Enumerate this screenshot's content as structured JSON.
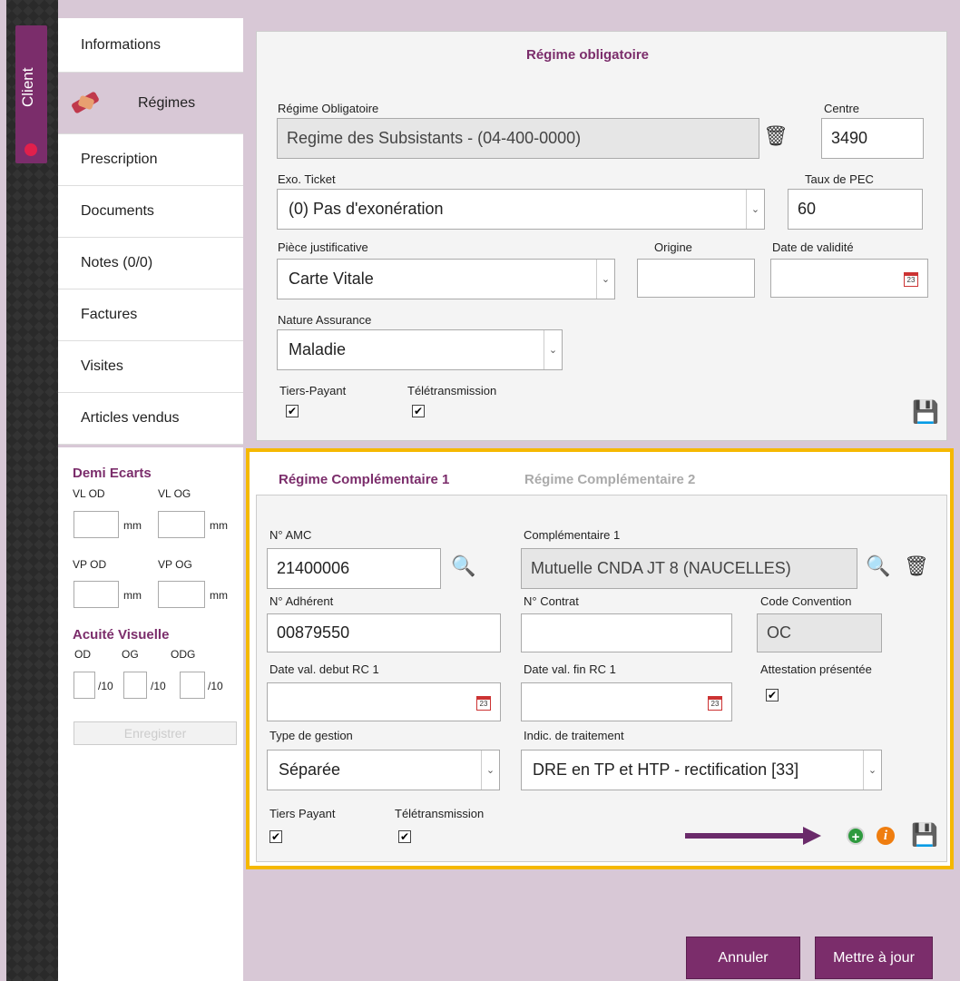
{
  "sidebar": {
    "client_tab": "Client",
    "items": [
      {
        "label": "Informations"
      },
      {
        "label": "Régimes"
      },
      {
        "label": "Prescription"
      },
      {
        "label": "Documents"
      },
      {
        "label": "Notes (0/0)"
      },
      {
        "label": "Factures"
      },
      {
        "label": "Visites"
      },
      {
        "label": "Articles vendus"
      }
    ]
  },
  "demi_ecarts": {
    "title": "Demi Ecarts",
    "vl_od": "VL OD",
    "vl_og": "VL OG",
    "vp_od": "VP OD",
    "vp_og": "VP OG",
    "unit": "mm"
  },
  "acuite": {
    "title": "Acuité Visuelle",
    "od": "OD",
    "og": "OG",
    "odg": "ODG",
    "unit": "/10"
  },
  "enregistrer": "Enregistrer",
  "regime_obligatoire": {
    "title": "Régime obligatoire",
    "regime_label": "Régime Obligatoire",
    "regime_value": "Regime des Subsistants - (04-400-0000)",
    "centre_label": "Centre",
    "centre_value": "3490",
    "exo_label": "Exo. Ticket",
    "exo_value": "(0) Pas d'exonération",
    "taux_label": "Taux de PEC",
    "taux_value": "60",
    "piece_label": "Pièce justificative",
    "piece_value": "Carte Vitale",
    "origine_label": "Origine",
    "origine_value": "",
    "date_validite_label": "Date de validité",
    "nature_label": "Nature Assurance",
    "nature_value": "Maladie",
    "tiers_payant_label": "Tiers-Payant",
    "teletransmission_label": "Télétransmission"
  },
  "regime_complementaire": {
    "tab1": "Régime Complémentaire 1",
    "tab2": "Régime Complémentaire 2",
    "amc_label": "N° AMC",
    "amc_value": "21400006",
    "comp_label": "Complémentaire 1",
    "comp_value": "Mutuelle CNDA JT 8 (NAUCELLES)",
    "adherent_label": "N° Adhérent",
    "adherent_value": "00879550",
    "contrat_label": "N° Contrat",
    "contrat_value": "",
    "convention_label": "Code Convention",
    "convention_value": "OC",
    "debut_label": "Date val. debut RC 1",
    "fin_label": "Date val. fin RC 1",
    "attestation_label": "Attestation présentée",
    "gestion_label": "Type de gestion",
    "gestion_value": "Séparée",
    "indic_label": "Indic. de traitement",
    "indic_value": "DRE en TP et HTP - rectification [33]",
    "tiers_payant_label": "Tiers Payant",
    "teletransmission_label": "Télétransmission"
  },
  "calendar_day": "23",
  "checkmark": "✔",
  "buttons": {
    "annuler": "Annuler",
    "mettre_a_jour": "Mettre à jour"
  },
  "colors": {
    "accent": "#7b2d6b",
    "highlight": "#f5b800",
    "background": "#d8c8d6"
  }
}
